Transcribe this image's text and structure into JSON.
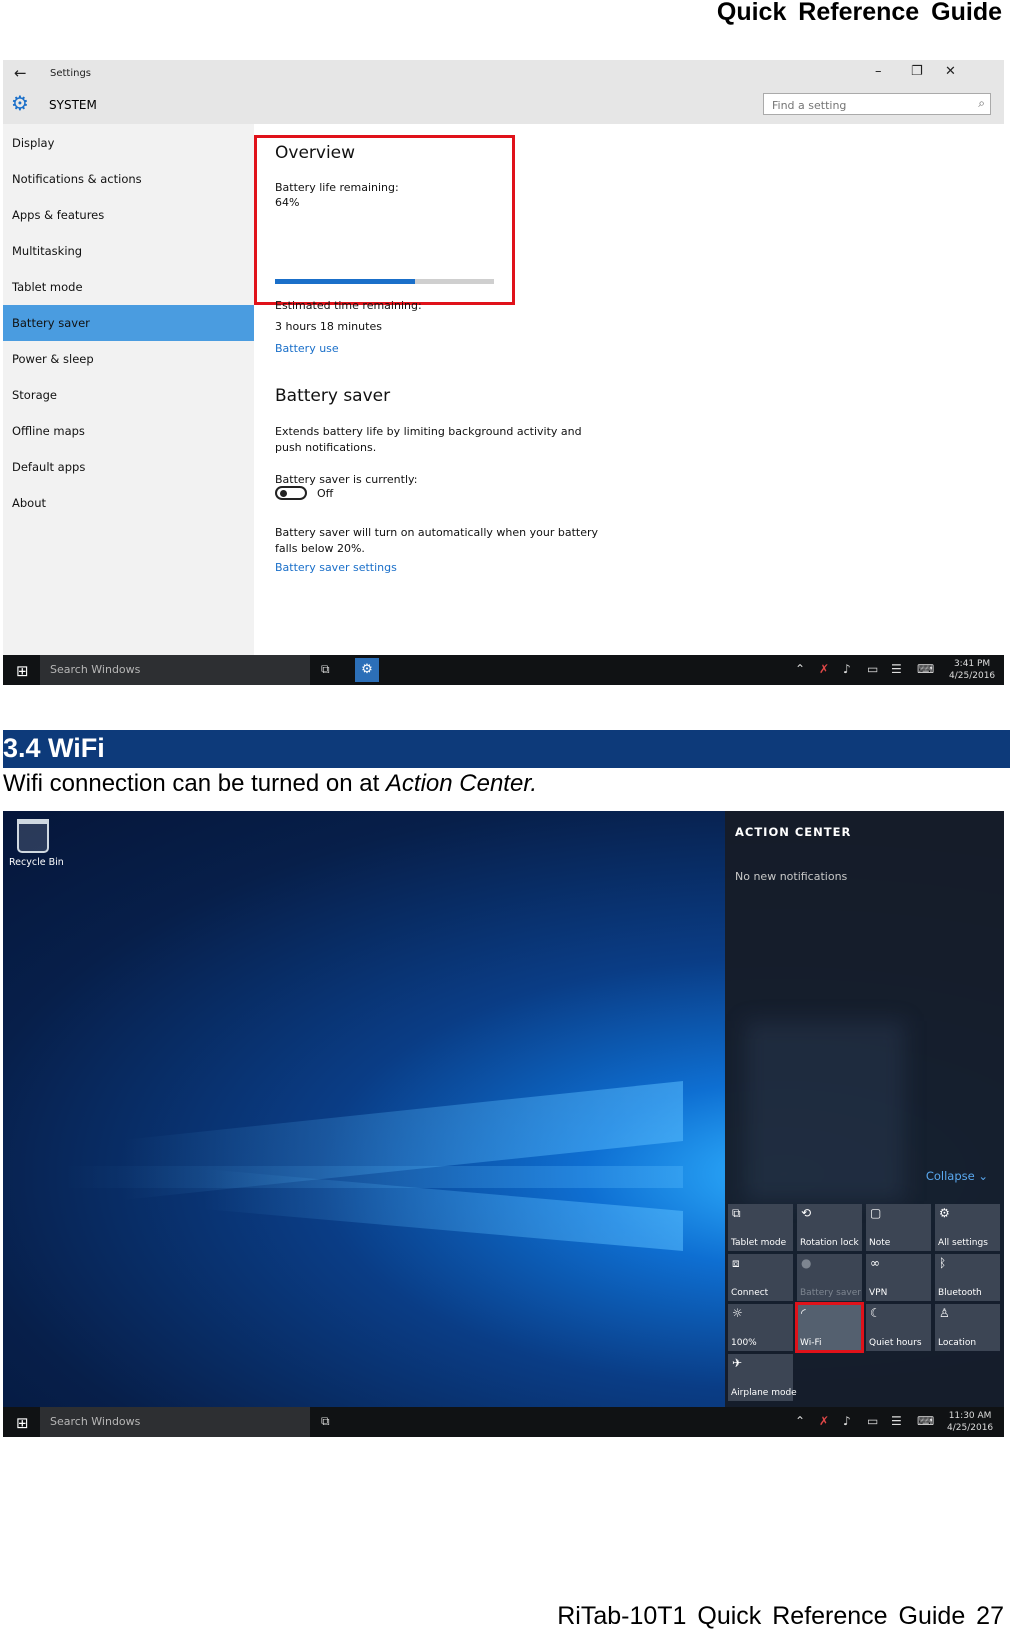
{
  "doc": {
    "header": "Quick Reference Guide",
    "footer": "RiTab-10T1 Quick Reference Guide 27"
  },
  "settings": {
    "app_title": "Settings",
    "section": "SYSTEM",
    "search_placeholder": "Find a setting",
    "icons": {
      "back": "back-arrow-icon",
      "gear": "gear-icon",
      "search": "search-icon"
    },
    "window_controls": [
      "–",
      "❐",
      "✕"
    ],
    "nav": [
      {
        "label": "Display"
      },
      {
        "label": "Notifications & actions"
      },
      {
        "label": "Apps & features"
      },
      {
        "label": "Multitasking"
      },
      {
        "label": "Tablet mode"
      },
      {
        "label": "Battery saver",
        "selected": true
      },
      {
        "label": "Power & sleep"
      },
      {
        "label": "Storage"
      },
      {
        "label": "Offline maps"
      },
      {
        "label": "Default apps"
      },
      {
        "label": "About"
      }
    ],
    "overview": {
      "heading": "Overview",
      "life_label": "Battery life remaining:",
      "life_value": "64%",
      "life_fraction": 0.64,
      "time_label": "Estimated time remaining:",
      "time_value": "3 hours 18 minutes",
      "link": "Battery use"
    },
    "saver": {
      "heading": "Battery saver",
      "desc": "Extends battery life by limiting background activity and push notifications.",
      "status_label": "Battery saver is currently:",
      "toggle_state": "Off",
      "auto_text": "Battery saver will turn on automatically when your battery falls below 20%.",
      "link": "Battery saver settings"
    },
    "accent_color": "#1a6fc9",
    "highlight_color": "#e0121a",
    "taskbar": {
      "search": "Search Windows",
      "time": "3:41 PM",
      "date": "4/25/2016"
    }
  },
  "section": {
    "title": "3.4 WiFi",
    "text_prefix": "Wifi connection can be turned on at ",
    "text_emphasis": "Action Center."
  },
  "desktop": {
    "recycle_bin": "Recycle Bin",
    "action_center": {
      "title": "ACTION CENTER",
      "notifications": "No new notifications",
      "collapse": "Collapse",
      "tiles": [
        {
          "label": "Tablet mode",
          "icon": "tablet-mode-icon"
        },
        {
          "label": "Rotation lock",
          "icon": "rotation-lock-icon"
        },
        {
          "label": "Note",
          "icon": "note-icon"
        },
        {
          "label": "All settings",
          "icon": "gear-icon"
        },
        {
          "label": "Connect",
          "icon": "connect-icon"
        },
        {
          "label": "Battery saver",
          "icon": "battery-saver-icon",
          "disabled": true
        },
        {
          "label": "VPN",
          "icon": "vpn-icon"
        },
        {
          "label": "Bluetooth",
          "icon": "bluetooth-icon"
        },
        {
          "label": "100%",
          "icon": "brightness-icon"
        },
        {
          "label": "Wi-Fi",
          "icon": "wifi-icon",
          "highlighted": true
        },
        {
          "label": "Quiet hours",
          "icon": "moon-icon"
        },
        {
          "label": "Location",
          "icon": "location-icon"
        },
        {
          "label": "Airplane mode",
          "icon": "airplane-icon"
        }
      ]
    },
    "taskbar": {
      "search": "Search Windows",
      "time": "11:30 AM",
      "date": "4/25/2016"
    }
  }
}
